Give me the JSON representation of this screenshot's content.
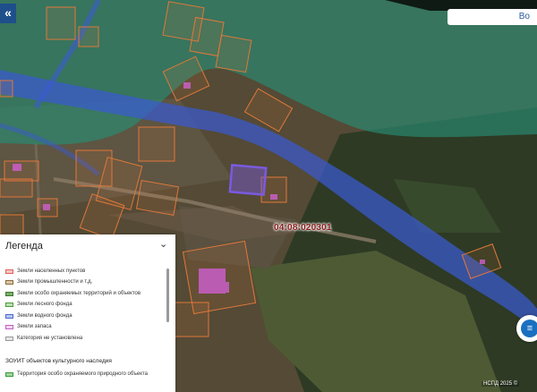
{
  "map": {
    "cadastral_label": "04:08:020301",
    "copyright": "НСПД 2025 ©"
  },
  "header": {
    "collapse_icon": "«",
    "search_partial": "Во"
  },
  "legend": {
    "title": "Легенда",
    "close_icon": "chevron-collapse-icon",
    "close_glyph": "⌄",
    "items": [
      {
        "label": "Земли населенных пунктов",
        "color": "#f4c7c3",
        "border": "#e06060"
      },
      {
        "label": "Земли промышленности и т.д.",
        "color": "#d9c6a8",
        "border": "#8a6a3a"
      },
      {
        "label": "Земли особо охраняемых территорий и объектов",
        "color": "#7dad6b",
        "border": "#3a7a2a"
      },
      {
        "label": "Земли лесного фонда",
        "color": "#b9e3b0",
        "border": "#4a9a3a"
      },
      {
        "label": "Земли водного фонда",
        "color": "#b9c7f0",
        "border": "#4a6ad0"
      },
      {
        "label": "Земли запаса",
        "color": "#f2d5f2",
        "border": "#c060c0"
      },
      {
        "label": "Категория не установлена",
        "color": "#e6e6e6",
        "border": "#999999"
      }
    ],
    "section_title": "ЗОУИТ объектов культурного наследия",
    "section_items": [
      {
        "label": "Территория особо охраняемого природного объекта",
        "color": "#9fd89f",
        "border": "#3a9a3a"
      }
    ]
  },
  "fab": {
    "icon": "list-icon",
    "glyph": "≡"
  }
}
